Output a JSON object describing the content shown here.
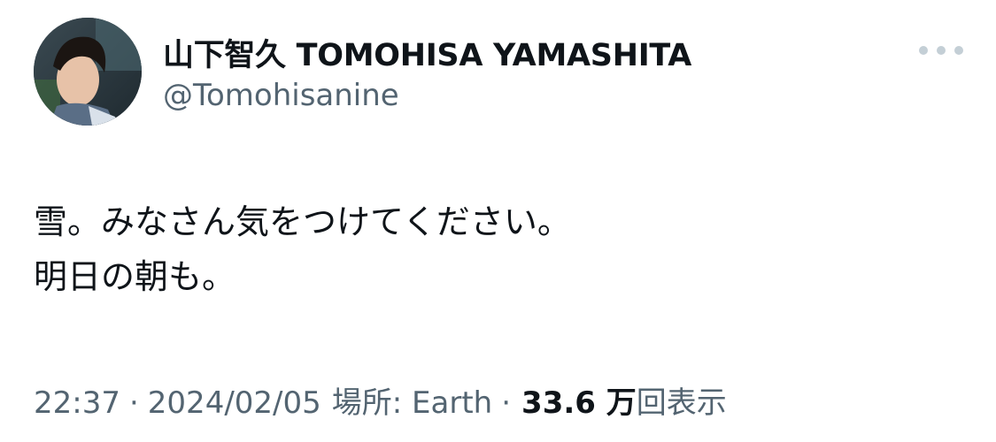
{
  "author": {
    "display_name": "山下智久 TOMOHISA YAMASHITA",
    "handle": "@Tomohisanine",
    "avatar_icon": "profile-photo"
  },
  "menu": {
    "more_icon": "ellipsis-icon"
  },
  "tweet": {
    "lines": [
      "雪。みなさん気をつけてください。",
      "明日の朝も。"
    ]
  },
  "meta": {
    "time": "22:37",
    "separator": "·",
    "date": "2024/02/05",
    "location": "場所: Earth",
    "views_count": "33.6 万",
    "views_label": "回表示"
  },
  "colors": {
    "text_primary": "#0f1419",
    "text_secondary": "#536471",
    "dots": "#c4cfd6"
  }
}
